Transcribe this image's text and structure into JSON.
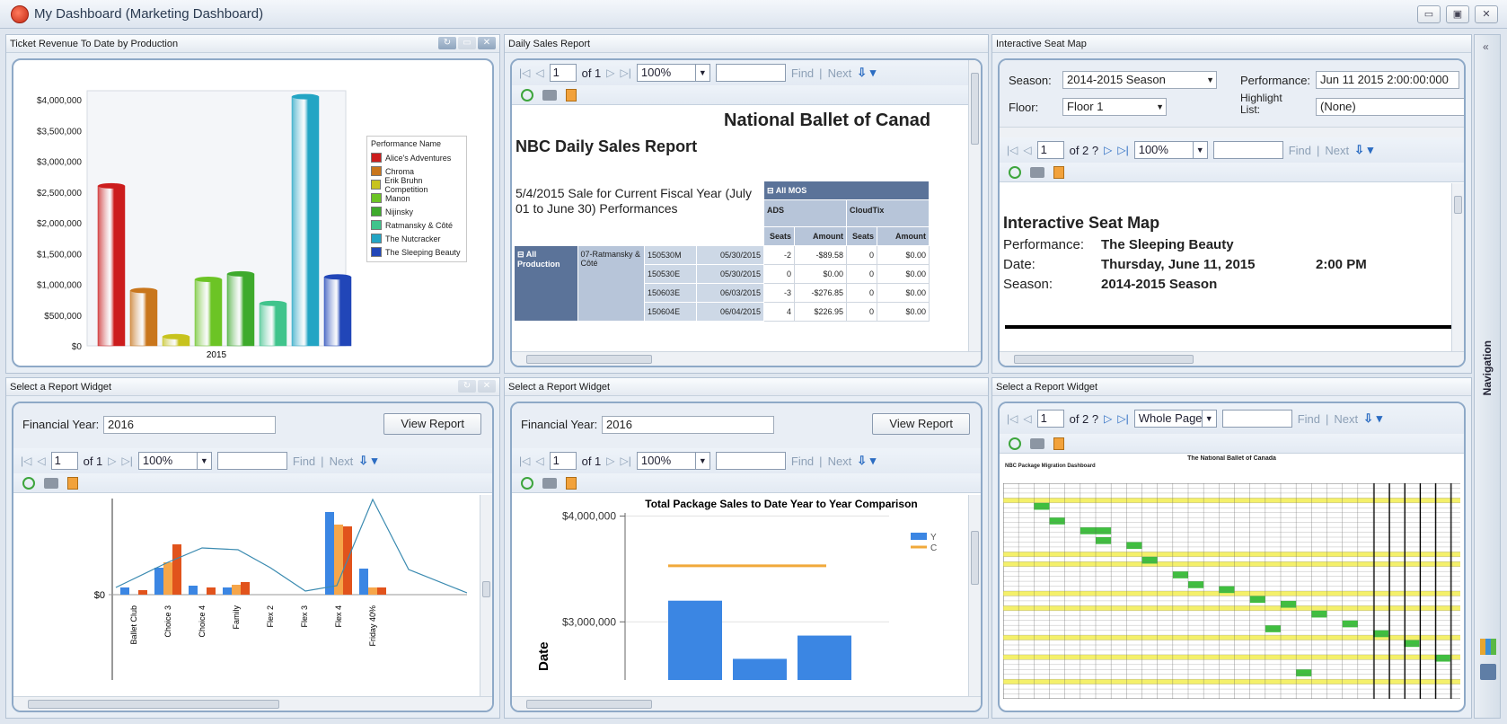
{
  "window": {
    "title": "My Dashboard (Marketing Dashboard)",
    "buttons": [
      "▭",
      "▣",
      "✕"
    ]
  },
  "navigation": {
    "label": "Navigation",
    "collapse": "«"
  },
  "panels": {
    "revenue": {
      "title": "Ticket Revenue To Date by Production"
    },
    "daily": {
      "title": "Daily Sales Report"
    },
    "seatmap": {
      "title": "Interactive Seat Map"
    },
    "widget1": {
      "title": "Select a Report Widget"
    },
    "widget2": {
      "title": "Select a Report Widget"
    },
    "widget3": {
      "title": "Select a Report Widget"
    }
  },
  "toolbar": {
    "first": "|◁",
    "prev": "◁",
    "next": "▷",
    "last": "▷|",
    "of1": "of 1",
    "of2": "of 2 ?",
    "page": "1",
    "zoom": "100%",
    "whole_page": "Whole Page",
    "find": "Find",
    "sep": "|",
    "next_label": "Next",
    "export": "⇩ ▾",
    "dropdown": "▼"
  },
  "chart_data": [
    {
      "type": "bar",
      "title": "",
      "categories": [
        "2015"
      ],
      "series": [
        {
          "name": "Alice's Adventures",
          "values": [
            2600000
          ],
          "color": "#cc1d1d"
        },
        {
          "name": "Chroma",
          "values": [
            900000
          ],
          "color": "#c9761c"
        },
        {
          "name": "Erik Bruhn Competition",
          "values": [
            150000
          ],
          "color": "#c7c31e"
        },
        {
          "name": "Manon",
          "values": [
            1080000
          ],
          "color": "#6cc425"
        },
        {
          "name": "Nijinsky",
          "values": [
            1170000
          ],
          "color": "#3eaa2c"
        },
        {
          "name": "Ratmansky & Côté",
          "values": [
            690000
          ],
          "color": "#40c48c"
        },
        {
          "name": "The Nutcracker",
          "values": [
            4050000
          ],
          "color": "#23a5c4"
        },
        {
          "name": "The Sleeping Beauty",
          "values": [
            1120000
          ],
          "color": "#2146b8"
        }
      ],
      "legend_title": "Performance Name",
      "yticks": [
        "$4,000,000",
        "$3,500,000",
        "$3,000,000",
        "$2,500,000",
        "$2,000,000",
        "$1,500,000",
        "$1,000,000",
        "$500,000",
        "$0"
      ],
      "ylim": [
        0,
        4000000
      ],
      "legend": "right"
    },
    {
      "type": "bar",
      "title": "Total Package Sales to Date Year to Year Comparison",
      "categories": [
        "",
        "",
        ""
      ],
      "series": [
        {
          "name": "Y",
          "values": [
            3200000,
            2650000,
            2870000
          ],
          "color": "#3b86e3"
        }
      ],
      "reference_line": {
        "name": "C",
        "value": 3530000,
        "color": "#f0a93b"
      },
      "yticks": [
        "$4,000,000",
        "$3,000,000"
      ],
      "ylim": [
        2450000,
        4200000
      ],
      "ylabel": "Date",
      "legend": "right"
    }
  ],
  "daily_report": {
    "org": "National Ballet of Canad",
    "title": "NBC Daily Sales Report",
    "subtitle": "5/4/2015 Sale for Current Fiscal Year (July 01 to June 30) Performances",
    "group": "⊟ All MOS",
    "col_ads": "ADS",
    "col_cloud": "CloudTix",
    "h_seats": "Seats",
    "h_amount": "Amount",
    "all_prod": "⊟ All Production",
    "production": "07-Ratmansky & Côté",
    "rows": [
      [
        "150530M",
        "05/30/2015",
        "-2",
        "-$89.58",
        "0",
        "$0.00"
      ],
      [
        "150530E",
        "05/30/2015",
        "0",
        "$0.00",
        "0",
        "$0.00"
      ],
      [
        "150603E",
        "06/03/2015",
        "-3",
        "-$276.85",
        "0",
        "$0.00"
      ],
      [
        "150604E",
        "06/04/2015",
        "4",
        "$226.95",
        "0",
        "$0.00"
      ]
    ]
  },
  "seatmap": {
    "season_label": "Season:",
    "season_value": "2014-2015 Season",
    "performance_label": "Performance:",
    "performance_value": "Jun 11 2015  2:00:00:000",
    "floor_label": "Floor:",
    "floor_value": "Floor 1",
    "highlight_label": "Highlight List:",
    "highlight_value": "(None)",
    "report_title": "Interactive Seat Map",
    "perf_k": "Performance:",
    "perf_v": "The Sleeping Beauty",
    "date_k": "Date:",
    "date_v": "Thursday, June 11, 2015",
    "time_v": "2:00 PM",
    "season_k": "Season:",
    "season_v": "2014-2015 Season"
  },
  "widget1": {
    "fy_label": "Financial Year:",
    "fy_value": "2016",
    "view": "View Report",
    "y_zero": "$0",
    "categories": [
      "Ballet Club",
      "Choice 3",
      "Choice 4",
      "Family",
      "Flex 2",
      "Flex 3",
      "Flex 4",
      "Friday 40%"
    ]
  },
  "widget2": {
    "fy_label": "Financial Year:",
    "fy_value": "2016",
    "view": "View Report"
  },
  "widget3": {
    "sheet_title": "The National Ballet of Canada",
    "sheet_subtitle": "NBC Package Migration Dashboard"
  }
}
